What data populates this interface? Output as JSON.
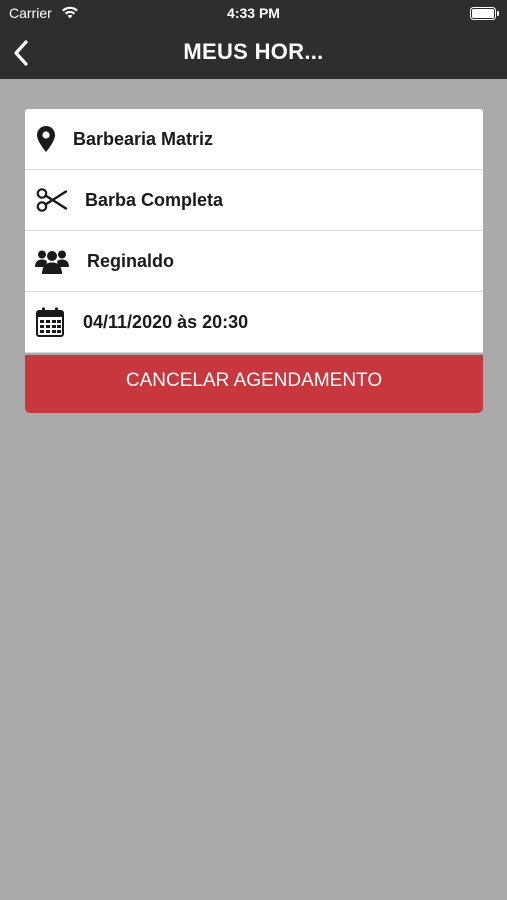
{
  "status_bar": {
    "carrier": "Carrier",
    "time": "4:33 PM"
  },
  "nav": {
    "title": "MEUS HOR..."
  },
  "details": {
    "location": "Barbearia Matriz",
    "service": "Barba Completa",
    "professional": "Reginaldo",
    "datetime": "04/11/2020 às 20:30"
  },
  "actions": {
    "cancel_label": "CANCELAR AGENDAMENTO"
  },
  "colors": {
    "header": "#2e2e2e",
    "background": "#aaaaaa",
    "danger": "#c8373d"
  }
}
